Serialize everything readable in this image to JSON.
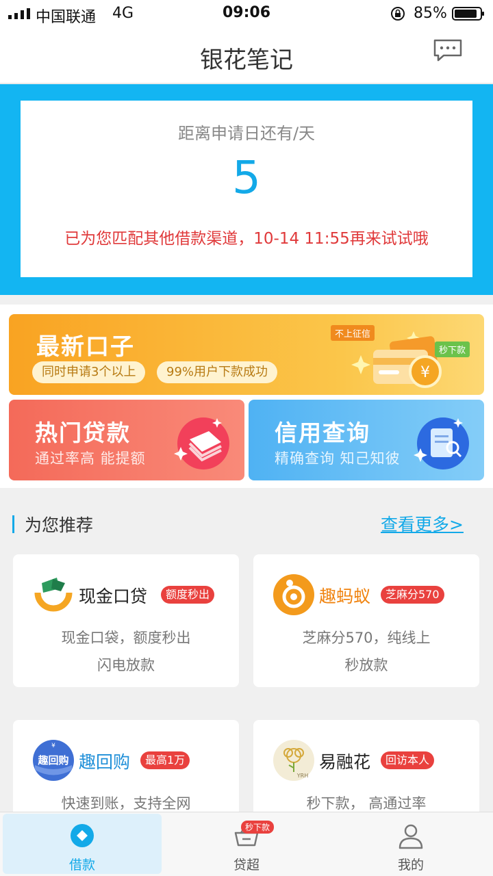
{
  "status_bar": {
    "carrier": "中国联通",
    "network": "4G",
    "time": "09:06",
    "battery": "85%"
  },
  "header": {
    "title": "银花笔记"
  },
  "countdown": {
    "label": "距离申请日还有/天",
    "days": "5",
    "notice": "已为您匹配其他借款渠道，10-14 11:55再来试试哦"
  },
  "banner": {
    "title": "最新口子",
    "pill1": "同时申请3个以上",
    "pill2": "99%用户下款成功",
    "tag1": "不上征信",
    "tag2": "秒下款"
  },
  "cards": {
    "hot": {
      "title": "热门贷款",
      "sub": "通过率高 能提额"
    },
    "credit": {
      "title": "信用查询",
      "sub": "精确查询 知己知彼"
    }
  },
  "recommend": {
    "title": "为您推荐",
    "more": "查看更多>"
  },
  "products": [
    {
      "name": "现金口贷",
      "badge": "额度秒出",
      "desc1": "现金口袋，额度秒出",
      "desc2": "闪电放款"
    },
    {
      "name": "趣蚂蚁",
      "badge": "芝麻分570",
      "desc1": "芝麻分570，纯线上",
      "desc2": "秒放款"
    },
    {
      "name": "趣回购",
      "badge": "最高1万",
      "desc1": "快速到账，支持全网",
      "desc2": "",
      "logo_text": "趣回购"
    },
    {
      "name": "易融花",
      "badge": "回访本人",
      "desc1": "秒下款， 高通过率",
      "desc2": "",
      "logo_text": "YRH"
    }
  ],
  "tabbar": {
    "loan": "借款",
    "super": "贷超",
    "super_badge": "秒下款",
    "mine": "我的"
  },
  "colors": {
    "accent": "#13a9e8",
    "warn": "#e0393a",
    "badge": "#e9413e"
  }
}
